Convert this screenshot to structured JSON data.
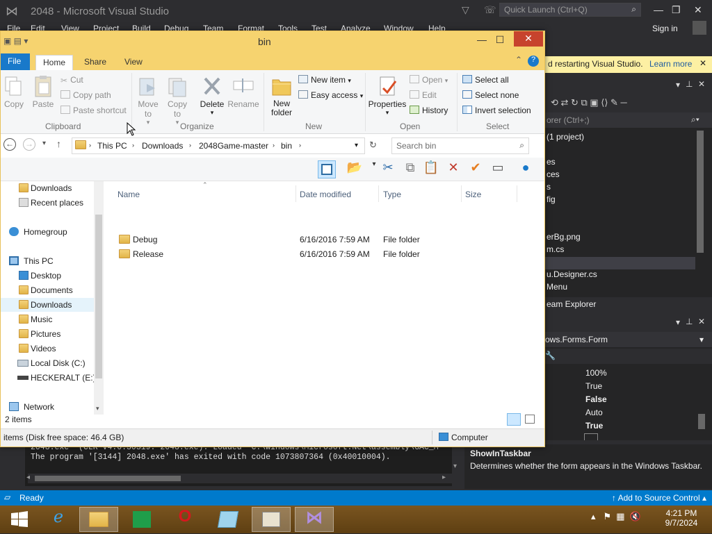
{
  "vs": {
    "title": "2048 - Microsoft Visual Studio",
    "quick_launch": "Quick Launch (Ctrl+Q)",
    "menu": [
      "File",
      "Edit",
      "View",
      "Project",
      "Build",
      "Debug",
      "Team",
      "Format",
      "Tools",
      "Test",
      "Analyze",
      "Window",
      "Help"
    ],
    "sign_in": "Sign in",
    "infobar": {
      "text": "d restarting Visual Studio.",
      "link": "Learn more"
    },
    "solution_search": "orer (Ctrl+;)",
    "solution_items": [
      "(1 project)",
      "es",
      "ces",
      "s",
      "fig",
      "",
      "erBg.png",
      "m.cs",
      "",
      "u.Designer.cs",
      "Menu"
    ],
    "team_explorer": "eam Explorer",
    "props_object": "ows.Forms.Form",
    "props_values": [
      {
        "v": "100%",
        "bold": false
      },
      {
        "v": "True",
        "bold": false
      },
      {
        "v": "False",
        "bold": true
      },
      {
        "v": "Auto",
        "bold": false
      },
      {
        "v": "True",
        "bold": true
      }
    ],
    "desc_title": "ShowInTaskbar",
    "desc_text": "Determines whether the form appears in the Windows Taskbar.",
    "output_lines": [
      "   2048.exe' (CLR v4.0.30319: 2048.exe): Loaded 'C:\\Windows\\Microsoft.Net\\assembly\\GAC_M",
      "The program '[3144] 2048.exe' has exited with code 1073807364 (0x40010004)."
    ],
    "status": {
      "ready": "Ready",
      "source_control": "Add to Source Control"
    }
  },
  "explorer": {
    "title": "bin",
    "tabs": {
      "file": "File",
      "home": "Home",
      "share": "Share",
      "view": "View"
    },
    "ribbon": {
      "clipboard": {
        "copy": "Copy",
        "paste": "Paste",
        "cut": "Cut",
        "copy_path": "Copy path",
        "paste_shortcut": "Paste shortcut",
        "label": "Clipboard"
      },
      "organize": {
        "move_to": "Move to",
        "copy_to": "Copy to",
        "delete": "Delete",
        "rename": "Rename",
        "label": "Organize"
      },
      "new": {
        "new_folder": "New folder",
        "new_item": "New item",
        "easy_access": "Easy access",
        "label": "New"
      },
      "open": {
        "properties": "Properties",
        "open": "Open",
        "edit": "Edit",
        "history": "History",
        "label": "Open"
      },
      "select": {
        "select_all": "Select all",
        "select_none": "Select none",
        "invert": "Invert selection",
        "label": "Select"
      }
    },
    "breadcrumbs": [
      "This PC",
      "Downloads",
      "2048Game-master",
      "bin"
    ],
    "search_placeholder": "Search bin",
    "nav": [
      {
        "label": "Downloads",
        "type": "folder",
        "selected": false
      },
      {
        "label": "Recent places",
        "type": "folder",
        "selected": false
      },
      {
        "label": "Homegroup",
        "type": "homegroup",
        "selected": false
      },
      {
        "label": "This PC",
        "type": "pc",
        "selected": false
      },
      {
        "label": "Desktop",
        "type": "folder",
        "selected": false
      },
      {
        "label": "Documents",
        "type": "folder",
        "selected": false
      },
      {
        "label": "Downloads",
        "type": "folder",
        "selected": true
      },
      {
        "label": "Music",
        "type": "folder",
        "selected": false
      },
      {
        "label": "Pictures",
        "type": "folder",
        "selected": false
      },
      {
        "label": "Videos",
        "type": "folder",
        "selected": false
      },
      {
        "label": "Local Disk (C:)",
        "type": "disk",
        "selected": false
      },
      {
        "label": "HECKERALT (E:)",
        "type": "drive",
        "selected": false
      },
      {
        "label": "Network",
        "type": "network",
        "selected": false
      }
    ],
    "columns": {
      "name": "Name",
      "date": "Date modified",
      "type": "Type",
      "size": "Size"
    },
    "files": [
      {
        "name": "Debug",
        "date": "6/16/2016 7:59 AM",
        "type": "File folder",
        "size": ""
      },
      {
        "name": "Release",
        "date": "6/16/2016 7:59 AM",
        "type": "File folder",
        "size": ""
      }
    ],
    "item_count": "2 items",
    "status_left": "items (Disk free space: 46.4 GB)",
    "status_right": "Computer"
  },
  "taskbar": {
    "apps": [
      "start",
      "internet-explorer",
      "file-explorer",
      "store",
      "opera",
      "notepad",
      "task-manager",
      "visual-studio"
    ],
    "clock_time": "4:21 PM",
    "clock_date": "9/7/2024"
  }
}
